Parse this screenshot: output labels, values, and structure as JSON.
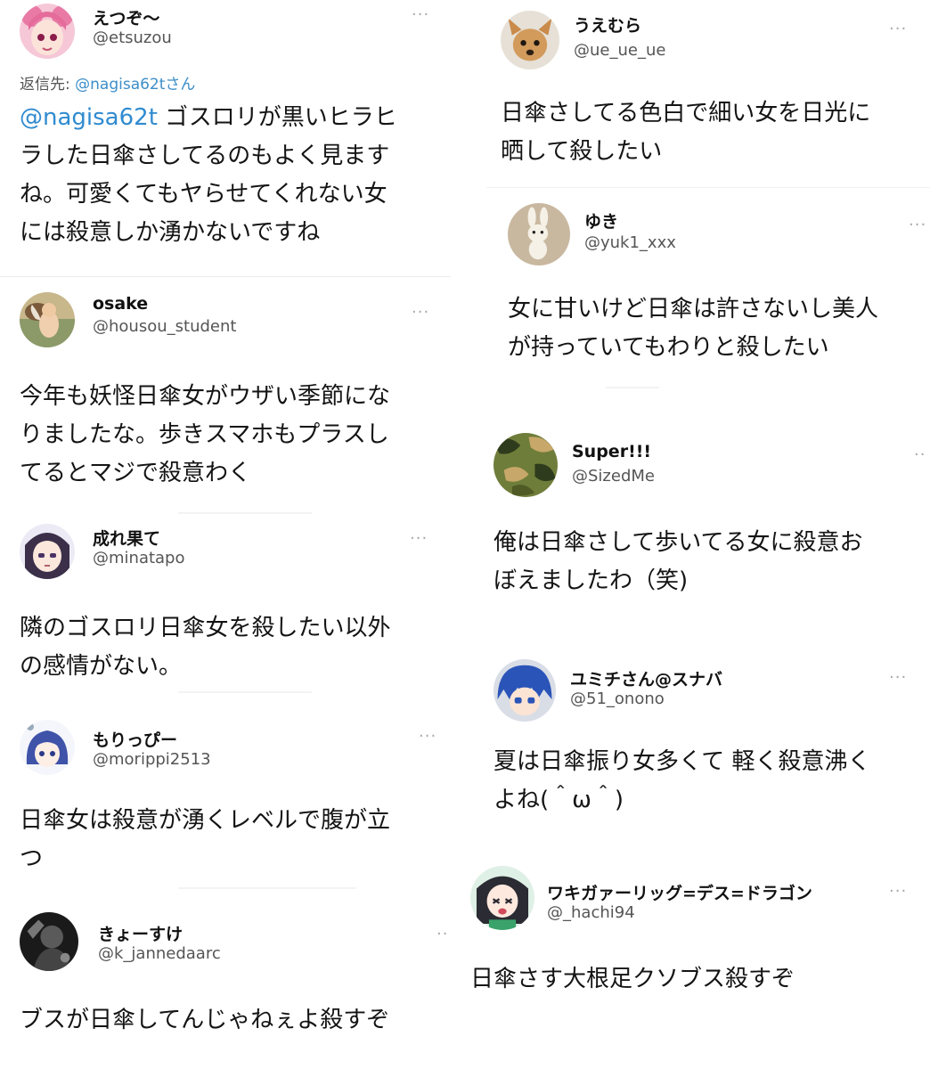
{
  "left_column": [
    {
      "name": "えつぞ〜",
      "handle": "@etsuzou",
      "reply_prefix": "返信先: ",
      "reply_mention": "@nagisa62t",
      "reply_suffix": "さん",
      "text_mention": "@nagisa62t",
      "text": " ゴスロリが黒いヒラヒ\nラした日傘さしてるのもよく見ます\nね。可愛くてもヤらせてくれない女\nには殺意しか湧かないですね",
      "more": "···",
      "avatar_icon": "avatar-pink-hair-anime-girl"
    },
    {
      "name": "osake",
      "handle": "@housou_student",
      "text": "今年も妖怪日傘女がウザい季節にな\nりましたな。歩きスマホもプラスし\nてるとマジで殺意わく",
      "more": "···",
      "avatar_icon": "avatar-cherub-painting"
    },
    {
      "name": "成れ果て",
      "handle": "@minatapo",
      "text": "隣のゴスロリ日傘女を殺したい以外\nの感情がない。",
      "more": "···",
      "avatar_icon": "avatar-dark-hair-anime-girl"
    },
    {
      "name": "もりっぴー",
      "handle": "@morippi2513",
      "text": "日傘女は殺意が湧くレベルで腹が立\nつ",
      "more": "···",
      "avatar_icon": "avatar-blue-hair-chibi"
    },
    {
      "name": "きょーすけ",
      "handle": "@k_jannedaarc",
      "text": "ブスが日傘してんじゃねぇよ殺すぞ",
      "more": "··",
      "avatar_icon": "avatar-monochrome-photo"
    }
  ],
  "right_column": [
    {
      "name": "うえむら",
      "handle": "@ue_ue_ue",
      "text": "日傘さしてる色白で細い女を日光に\n晒して殺したい",
      "more": "···",
      "avatar_icon": "avatar-dog-photo"
    },
    {
      "name": "ゆき",
      "handle": "@yuk1_xxx",
      "text": "女に甘いけど日傘は許さないし美人\nが持っていてもわりと殺したい",
      "more": "···",
      "avatar_icon": "avatar-bunny-plush"
    },
    {
      "name": "Super!!!",
      "handle": "@SizedMe",
      "text": "俺は日傘さして歩いてる女に殺意お\nぼえましたわ（笑)",
      "more": "··",
      "avatar_icon": "avatar-camo-pattern"
    },
    {
      "name": "ユミチさん@スナバ",
      "handle": "@51_onono",
      "text": "夏は日傘振り女多くて 軽く殺意沸く\nよね(＾ω＾)",
      "more": "···",
      "avatar_icon": "avatar-blue-hair-anime-boy"
    },
    {
      "name": "ワキガァーリッグ=デス=ドラゴン",
      "handle": "@_hachi94",
      "text": "日傘さす大根足クソブス殺すぞ",
      "more": "···",
      "avatar_icon": "avatar-dark-hair-anime-girl-green"
    }
  ]
}
